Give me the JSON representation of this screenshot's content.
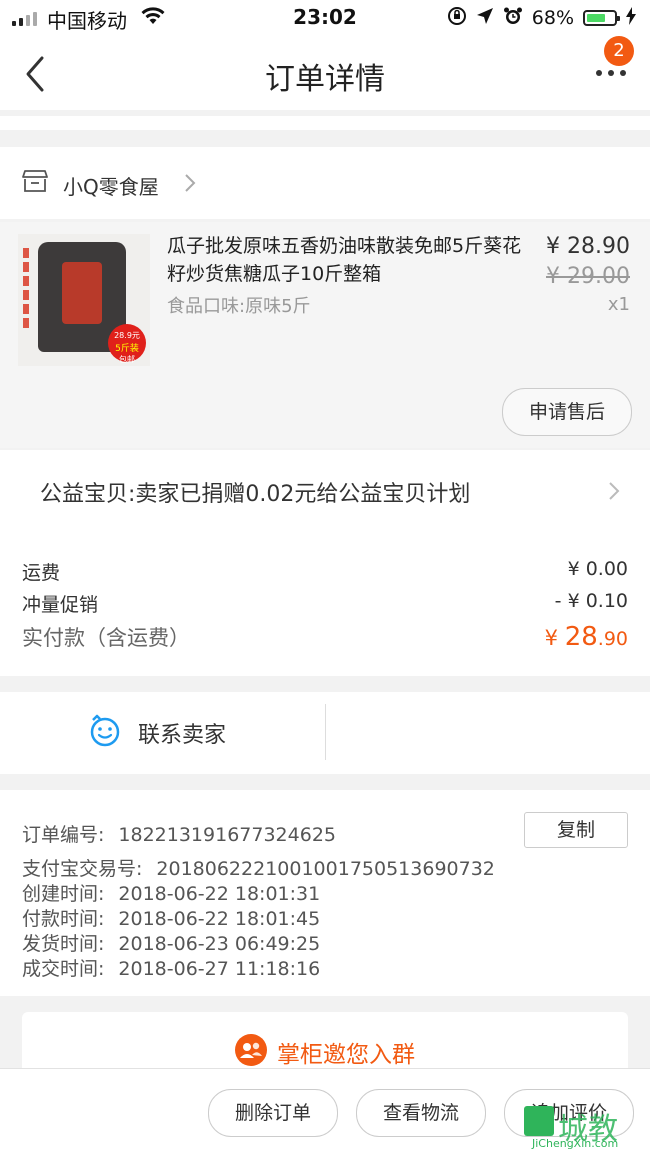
{
  "status_bar": {
    "carrier": "中国移动",
    "time": "23:02",
    "battery_percent": "68%",
    "battery_level": 0.68
  },
  "nav": {
    "title": "订单详情",
    "badge_count": "2",
    "back_icon": "chevron-left-icon",
    "more_icon": "more-dots-icon"
  },
  "shop": {
    "name": "小Q零食屋",
    "icon": "shop-icon"
  },
  "goods": {
    "title": "瓜子批发原味五香奶油味散装免邮5斤葵花籽炒货焦糖瓜子10斤整箱",
    "spec": "食品口味:原味5斤",
    "price": "¥ 28.90",
    "original_price": "¥ 29.00",
    "quantity": "x1",
    "image_badge_price": "28.9元",
    "image_badge_text": "5斤装",
    "image_badge_sub": "包邮",
    "after_sale_label": "申请售后"
  },
  "charity": {
    "text": "公益宝贝:卖家已捐赠0.02元给公益宝贝计划"
  },
  "fees": {
    "shipping_label": "运费",
    "shipping_value": "¥ 0.00",
    "promo_label": "冲量促销",
    "promo_value": "- ¥ 0.10",
    "total_label": "实付款（含运费）",
    "total_currency": "¥ ",
    "total_int": "28",
    "total_dec": ".90"
  },
  "contact": {
    "label": "联系卖家"
  },
  "order_info": {
    "order_no_label": "订单编号:",
    "order_no": "182213191677324625",
    "copy_label": "复制",
    "alipay_label": "支付宝交易号:",
    "alipay_no": "2018062221001001750513690732",
    "created_label": "创建时间:",
    "created": "2018-06-22 18:01:31",
    "paid_label": "付款时间:",
    "paid": "2018-06-22 18:01:45",
    "shipped_label": "发货时间:",
    "shipped": "2018-06-23 06:49:25",
    "completed_label": "成交时间:",
    "completed": "2018-06-27 11:18:16"
  },
  "group": {
    "label": "掌柜邀您入群"
  },
  "bottom_bar": {
    "delete_label": "删除订单",
    "logistics_label": "查看物流",
    "review_label": "追加评价"
  },
  "colors": {
    "accent": "#f25a12",
    "battery": "#4cd964"
  }
}
